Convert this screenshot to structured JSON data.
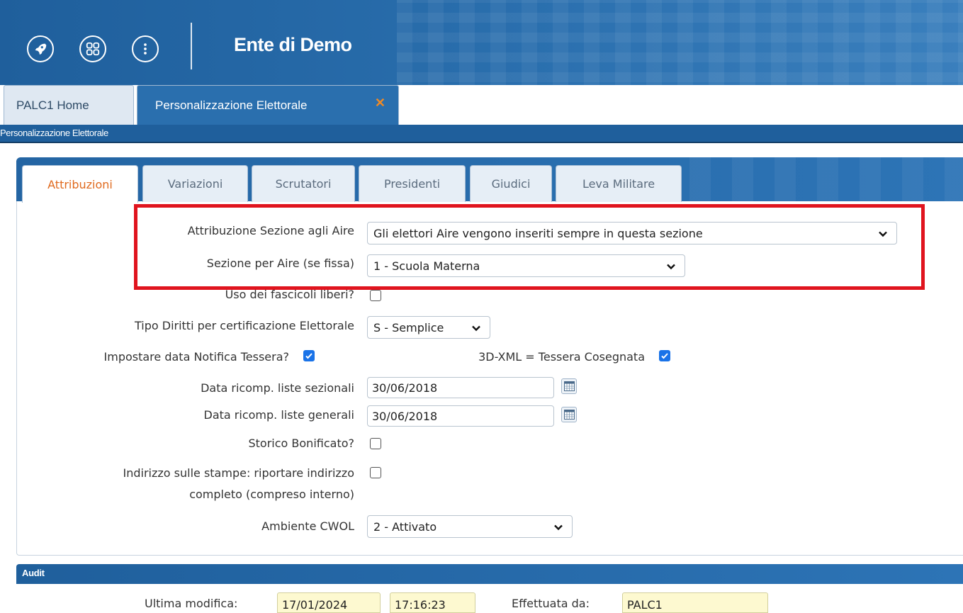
{
  "header": {
    "title": "Ente di Demo",
    "buttons": [
      {
        "icon": "rocket-icon"
      },
      {
        "icon": "apps-grid-icon"
      },
      {
        "icon": "more-vertical-icon"
      }
    ]
  },
  "app_tabs": [
    {
      "label": "PALC1 Home",
      "active": false
    },
    {
      "label": "Personalizzazione Elettorale",
      "active": true,
      "close": "✕"
    }
  ],
  "breadcrumb": "Personalizzazione Elettorale",
  "sub_tabs": [
    {
      "label": "Attribuzioni",
      "active": true
    },
    {
      "label": "Variazioni",
      "active": false
    },
    {
      "label": "Scrutatori",
      "active": false
    },
    {
      "label": "Presidenti",
      "active": false
    },
    {
      "label": "Giudici",
      "active": false
    },
    {
      "label": "Leva Militare",
      "active": false
    }
  ],
  "form": {
    "attribuzione_aire": {
      "label": "Attribuzione Sezione agli Aire",
      "value": "Gli elettori Aire vengono inseriti sempre in questa sezione"
    },
    "sezione_aire": {
      "label": "Sezione per Aire (se fissa)",
      "value": "1 - Scuola Materna"
    },
    "fascicoli_liberi": {
      "label": "Uso dei fascicoli liberi?",
      "checked": false
    },
    "tipo_diritti": {
      "label": "Tipo Diritti per certificazione Elettorale",
      "value": "S - Semplice"
    },
    "data_notifica": {
      "label": "Impostare data Notifica Tessera?",
      "checked": true
    },
    "tessera_consegnata": {
      "label": "3D-XML = Tessera Cosegnata",
      "checked": true
    },
    "data_ricomp_sezionali": {
      "label": "Data ricomp. liste sezionali",
      "value": "30/06/2018"
    },
    "data_ricomp_generali": {
      "label": "Data ricomp. liste generali",
      "value": "30/06/2018"
    },
    "storico_bonificato": {
      "label": "Storico Bonificato?",
      "checked": false
    },
    "indirizzo_stampe": {
      "label_line1": "Indirizzo sulle stampe: riportare indirizzo",
      "label_line2": "completo (compreso interno)",
      "checked": false
    },
    "ambiente_cwol": {
      "label": "Ambiente CWOL",
      "value": "2 - Attivato"
    }
  },
  "audit": {
    "title": "Audit",
    "ultima_modifica_label": "Ultima modifica:",
    "data": "17/01/2024",
    "ora": "17:16:23",
    "effettuata_da_label": "Effettuata da:",
    "utente": "PALC1"
  },
  "colors": {
    "header_blue": "#1f5f9c",
    "active_tab_text": "#e06a1e",
    "highlight_red": "#e0141e",
    "checkbox_blue": "#1a73e8",
    "audit_field_bg": "#fdf9d0"
  }
}
